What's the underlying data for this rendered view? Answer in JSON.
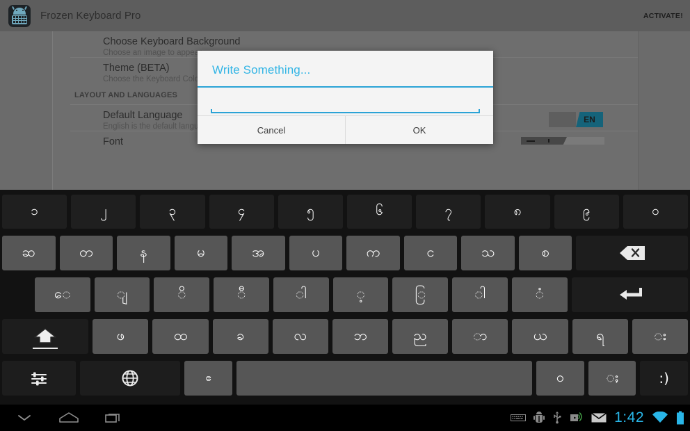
{
  "app": {
    "title": "Frozen Keyboard Pro",
    "activate_label": "ACTIVATE!",
    "icon": "android-keyboard-app-icon"
  },
  "settings": {
    "rows": [
      {
        "title": "Choose Keyboard Background",
        "subtitle": "Choose an image to appear"
      },
      {
        "title": "Theme (BETA)",
        "subtitle": "Choose the Keyboard Color"
      }
    ],
    "section_header": "LAYOUT AND LANGUAGES",
    "rows2": [
      {
        "title": "Default Language",
        "subtitle": "English is the default language",
        "badge": "EN"
      },
      {
        "title": "Font",
        "subtitle": ""
      }
    ]
  },
  "dialog": {
    "title": "Write Something...",
    "input_value": "",
    "input_placeholder": "",
    "cancel_label": "Cancel",
    "ok_label": "OK",
    "accent_color": "#33b5e5"
  },
  "keyboard": {
    "rows": [
      {
        "name": "row-digits",
        "keys": [
          {
            "label": "၁",
            "name": "key-myanmar-one",
            "style": "dark"
          },
          {
            "label": "၂",
            "name": "key-myanmar-two",
            "style": "dark"
          },
          {
            "label": "၃",
            "name": "key-myanmar-three",
            "style": "dark"
          },
          {
            "label": "၄",
            "name": "key-myanmar-four",
            "style": "dark"
          },
          {
            "label": "၅",
            "name": "key-myanmar-five",
            "style": "dark"
          },
          {
            "label": "၆",
            "name": "key-myanmar-six",
            "style": "dark"
          },
          {
            "label": "၇",
            "name": "key-myanmar-seven",
            "style": "dark"
          },
          {
            "label": "၈",
            "name": "key-myanmar-eight",
            "style": "dark"
          },
          {
            "label": "၉",
            "name": "key-myanmar-nine",
            "style": "dark"
          },
          {
            "label": "၀",
            "name": "key-myanmar-zero",
            "style": "dark"
          }
        ]
      },
      {
        "name": "row-consonants-1",
        "keys": [
          {
            "label": "ဆ",
            "name": "key-sa-lein"
          },
          {
            "label": "တ",
            "name": "key-ta-wun-bu"
          },
          {
            "label": "န",
            "name": "key-na-nge"
          },
          {
            "label": "မ",
            "name": "key-ma"
          },
          {
            "label": "အ",
            "name": "key-a"
          },
          {
            "label": "ပ",
            "name": "key-pa-zauk"
          },
          {
            "label": "က",
            "name": "key-ka-gyi"
          },
          {
            "label": "င",
            "name": "key-nga"
          },
          {
            "label": "သ",
            "name": "key-tha"
          },
          {
            "label": "စ",
            "name": "key-sa-lone"
          },
          {
            "label": "⌫",
            "name": "key-backspace",
            "style": "dark",
            "width": "wide2",
            "icon": "backspace-icon"
          }
        ]
      },
      {
        "name": "row-vowels",
        "keys": [
          {
            "label": "ေ",
            "name": "key-vowel-e"
          },
          {
            "label": "ျ",
            "name": "key-medial-ya"
          },
          {
            "label": "ိ",
            "name": "key-vowel-i"
          },
          {
            "label": "ီ",
            "name": "key-vowel-ii"
          },
          {
            "label": "ါ",
            "name": "key-vowel-tall-aa"
          },
          {
            "label": "့",
            "name": "key-dot-below"
          },
          {
            "label": "ြ",
            "name": "key-medial-ra"
          },
          {
            "label": "ါ",
            "name": "key-vowel-aa"
          },
          {
            "label": "ံ",
            "name": "key-anusvara"
          },
          {
            "label": "⏎",
            "name": "key-enter",
            "style": "dark",
            "width": "wide2",
            "icon": "enter-icon"
          }
        ]
      },
      {
        "name": "row-consonants-2",
        "keys": [
          {
            "label": "⇧",
            "name": "key-shift",
            "style": "dark",
            "width": "wide15",
            "icon": "shift-icon"
          },
          {
            "label": "ဖ",
            "name": "key-pha"
          },
          {
            "label": "ထ",
            "name": "key-hta-sin-du"
          },
          {
            "label": "ခ",
            "name": "key-kha-gwe"
          },
          {
            "label": "လ",
            "name": "key-la"
          },
          {
            "label": "ဘ",
            "name": "key-ba-gone"
          },
          {
            "label": "ည",
            "name": "key-nya"
          },
          {
            "label": "ာ",
            "name": "key-vowel-aa-2"
          },
          {
            "label": "ယ",
            "name": "key-ya"
          },
          {
            "label": "ရ",
            "name": "key-ra"
          },
          {
            "label": "း",
            "name": "key-visarga"
          }
        ]
      },
      {
        "name": "row-bottom",
        "keys": [
          {
            "label": "",
            "name": "key-keyboard-settings",
            "style": "dark",
            "width": "wide15",
            "icon": "sliders-icon"
          },
          {
            "label": "",
            "name": "key-language-switch",
            "style": "dark",
            "width": "wide2",
            "icon": "globe-icon"
          },
          {
            "label": "ဧ",
            "name": "key-e-vowel"
          },
          {
            "label": "",
            "name": "key-space",
            "width": "space",
            "icon": "space-icon"
          },
          {
            "label": "ဝ",
            "name": "key-wa"
          },
          {
            "label": "ႈ",
            "name": "key-double-stroke"
          },
          {
            "label": ":)",
            "name": "key-emoji",
            "style": "dark",
            "size": "tiny"
          }
        ]
      }
    ]
  },
  "system_bar": {
    "nav": [
      {
        "name": "hide-keyboard-icon",
        "label": "hide-keyboard"
      },
      {
        "name": "home-icon",
        "label": "home"
      },
      {
        "name": "recents-icon",
        "label": "recents"
      }
    ],
    "tray_icons": [
      {
        "name": "keyboard-status-icon"
      },
      {
        "name": "android-debug-icon"
      },
      {
        "name": "usb-icon"
      },
      {
        "name": "cast-icon"
      },
      {
        "name": "mail-icon"
      }
    ],
    "clock": "1:42",
    "wifi": "wifi-icon",
    "battery": "battery-icon"
  }
}
